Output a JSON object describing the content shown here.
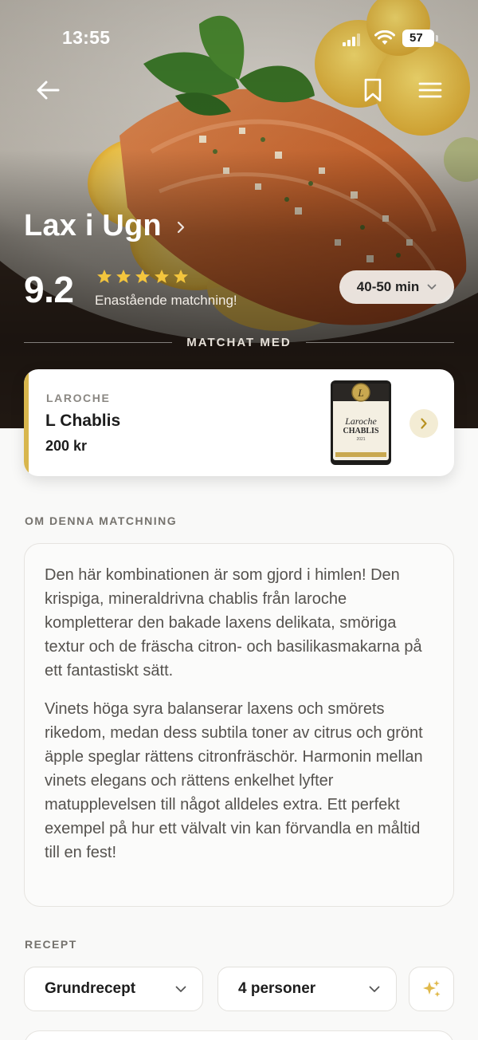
{
  "status_bar": {
    "time": "13:55",
    "battery": "57"
  },
  "recipe": {
    "title": "Lax i Ugn",
    "score": "9.2",
    "stars": 5,
    "match_text": "Enastående matchning!",
    "cook_time": "40-50 min"
  },
  "matched_with_label": "MATCHAT MED",
  "wine": {
    "producer": "LAROCHE",
    "name": "L Chablis",
    "price": "200 kr",
    "label_script": "Laroche",
    "label_title": "CHABLIS",
    "label_year": "2021",
    "accent_color": "#d8b64d"
  },
  "about": {
    "heading": "OM DENNA MATCHNING",
    "paragraphs": [
      "Den här kombinationen är som gjord i himlen! Den krispiga, mineraldrivna chablis från laroche kompletterar den bakade laxens delikata, smöriga textur och de fräscha citron- och basilikasmakarna på ett fantastiskt sätt.",
      "Vinets höga syra balanserar laxens och smörets rikedom, medan dess subtila toner av citrus och grönt äpple speglar rättens citronfräschör. Harmonin mellan vinets elegans och rättens enkelhet lyfter matupplevelsen till något alldeles extra. Ett perfekt exempel på hur ett välvalt vin kan förvandla en måltid till en fest!"
    ]
  },
  "recept": {
    "heading": "RECEPT",
    "variant": "Grundrecept",
    "servings": "4 personer"
  },
  "icons": [
    "back-arrow-icon",
    "bookmark-icon",
    "menu-icon",
    "chevron-right-icon",
    "star-icon",
    "chevron-down-icon",
    "sparkle-icon"
  ]
}
